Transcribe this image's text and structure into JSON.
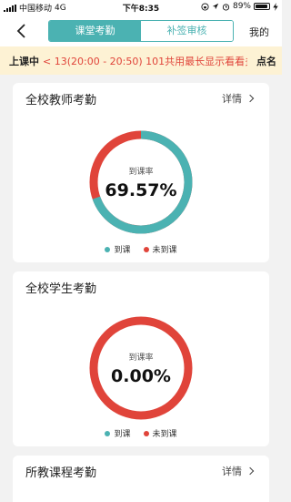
{
  "status": {
    "carrier": "中国移动",
    "network": "4G",
    "time": "下午8:35",
    "battery": "89%"
  },
  "nav": {
    "tabs": [
      {
        "label": "课堂考勤",
        "active": true
      },
      {
        "label": "补签审核",
        "active": false
      }
    ],
    "right_label": "我的"
  },
  "notice": {
    "label": "上课中",
    "text": "< 13(20:00 - 20:50) 101共用最长显示看看多",
    "action": "点名"
  },
  "colors": {
    "accent": "#4bb2b2",
    "present": "#4bb2b2",
    "absent": "#e0443a"
  },
  "cards": [
    {
      "title": "全校教师考勤",
      "link_label": "详情",
      "caption": "到课率",
      "value": "69.57%",
      "legend_present": "到课",
      "legend_absent": "未到课"
    },
    {
      "title": "全校学生考勤",
      "caption": "到课率",
      "value": "0.00%",
      "legend_present": "到课",
      "legend_absent": "未到课"
    },
    {
      "title": "所教课程考勤",
      "link_label": "详情"
    }
  ],
  "chart_data": [
    {
      "type": "pie",
      "categories": [
        "到课",
        "未到课"
      ],
      "values": [
        69.57,
        30.43
      ]
    },
    {
      "type": "pie",
      "categories": [
        "到课",
        "未到课"
      ],
      "values": [
        0,
        100
      ]
    }
  ]
}
